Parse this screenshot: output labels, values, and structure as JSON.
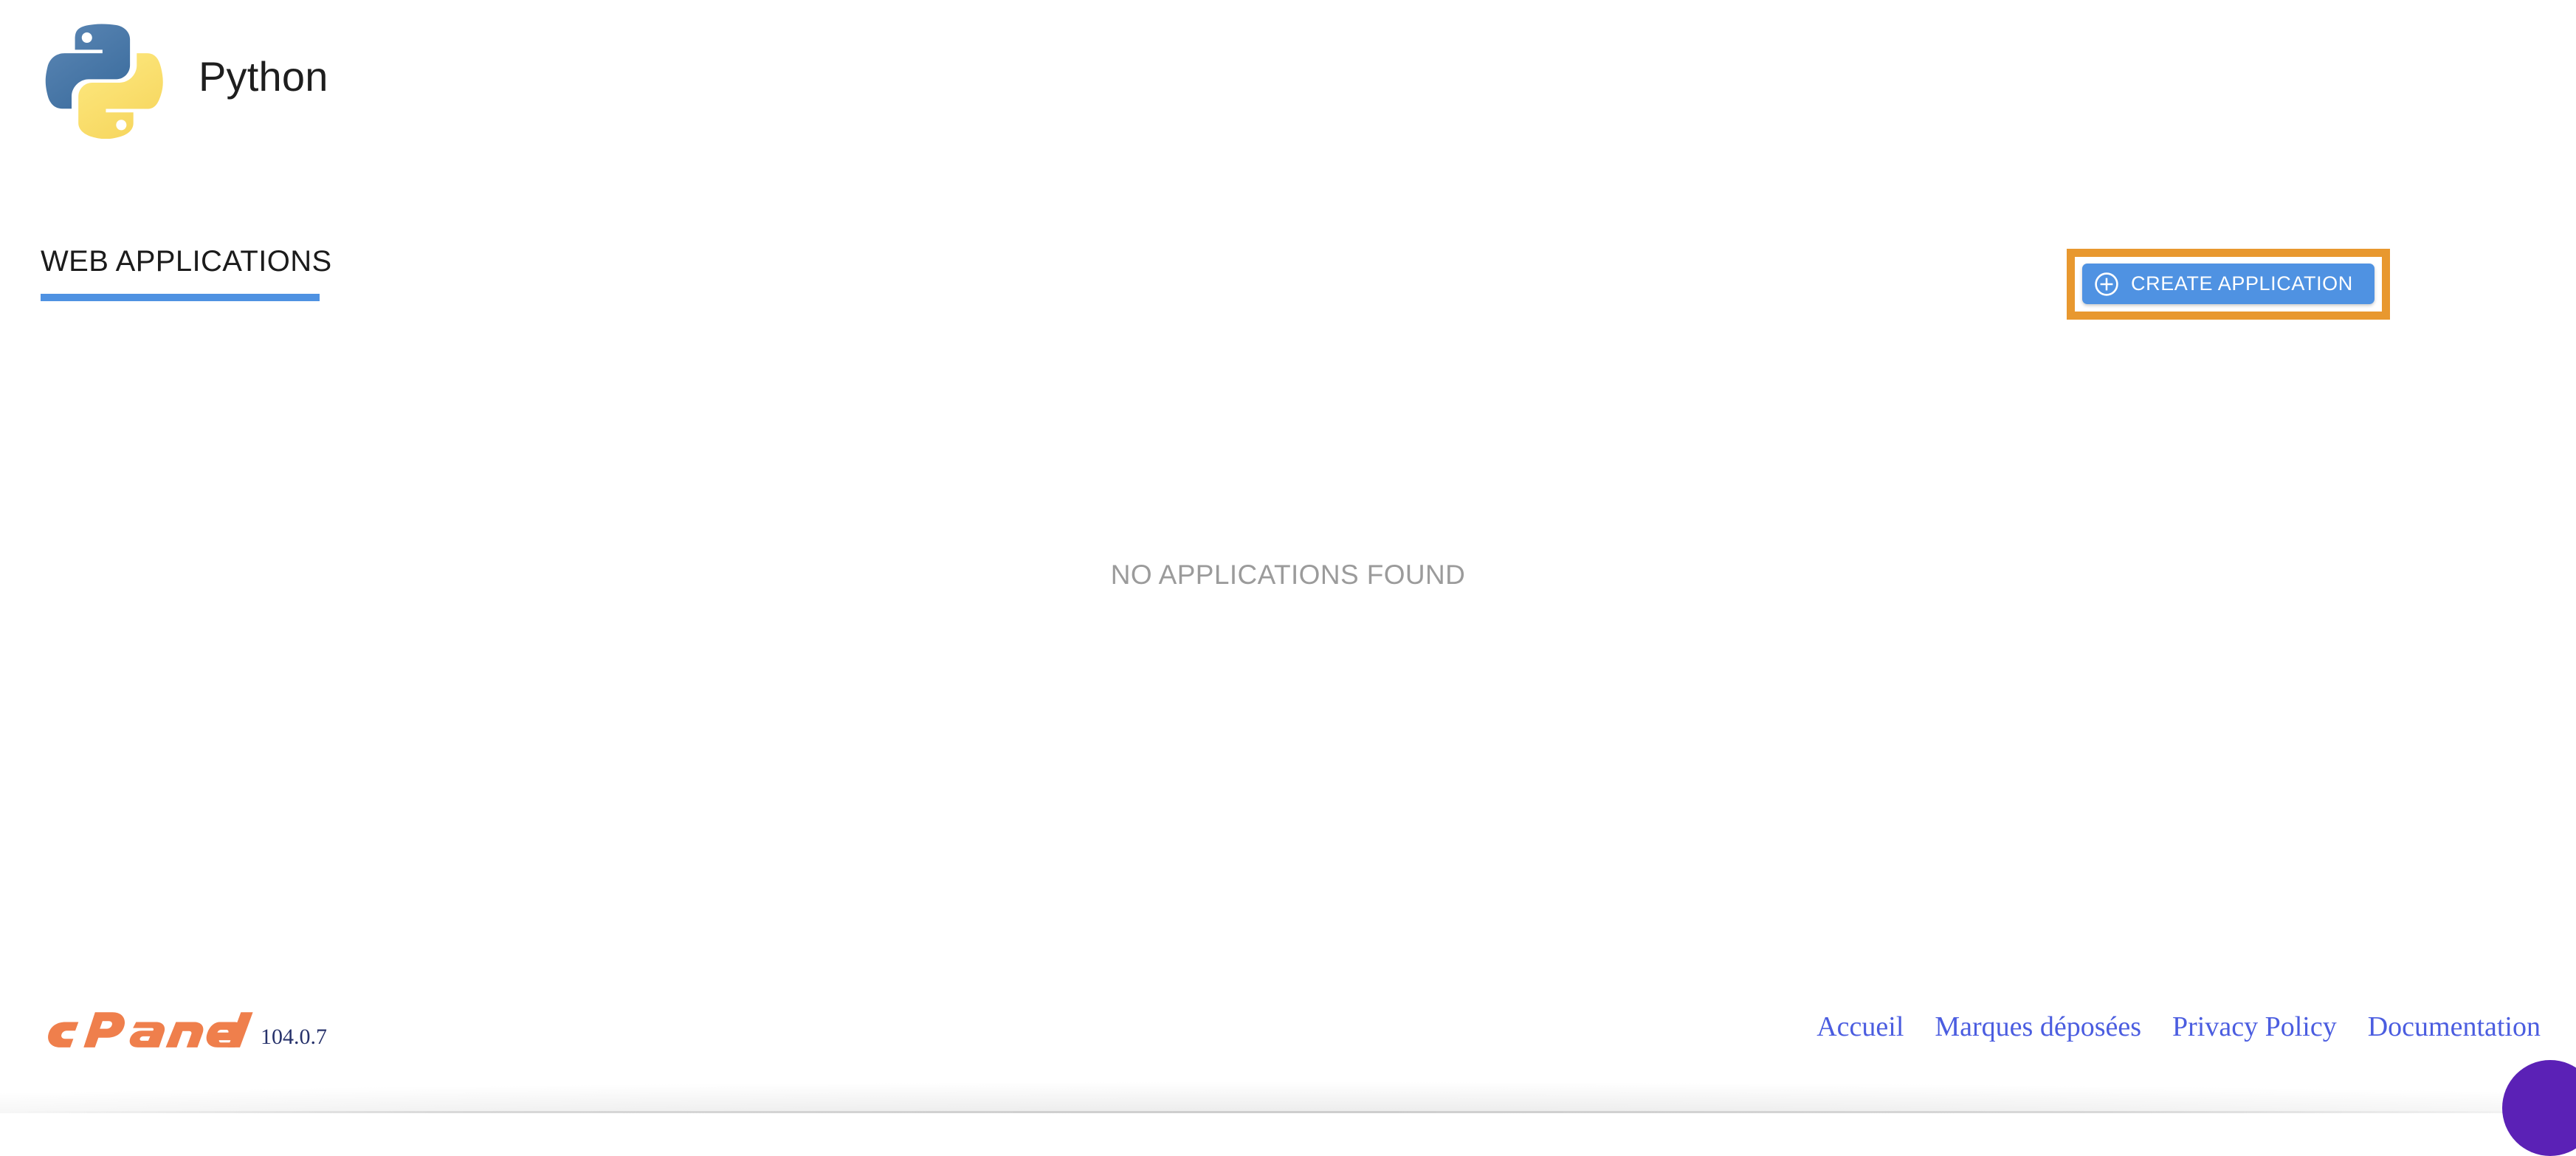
{
  "app": {
    "title": "Python",
    "logo_icon": "python-logo-icon"
  },
  "section": {
    "heading": "WEB APPLICATIONS",
    "accent_color": "#4f92e2"
  },
  "actions": {
    "create_application_label": "CREATE APPLICATION",
    "create_application_icon": "plus-circle-icon",
    "highlight_color": "#e8982f",
    "button_color": "#4f92e2"
  },
  "main": {
    "empty_state_text": "NO APPLICATIONS FOUND"
  },
  "footer": {
    "brand": "cPanel",
    "version": "104.0.7",
    "brand_color": "#ef7f4c",
    "version_color": "#27326b",
    "link_color": "#4b5de0",
    "links": [
      {
        "label": "Accueil"
      },
      {
        "label": "Marques déposées"
      },
      {
        "label": "Privacy Policy"
      },
      {
        "label": "Documentation"
      }
    ]
  },
  "widgets": {
    "chat_bubble_color": "#5b21b6"
  }
}
